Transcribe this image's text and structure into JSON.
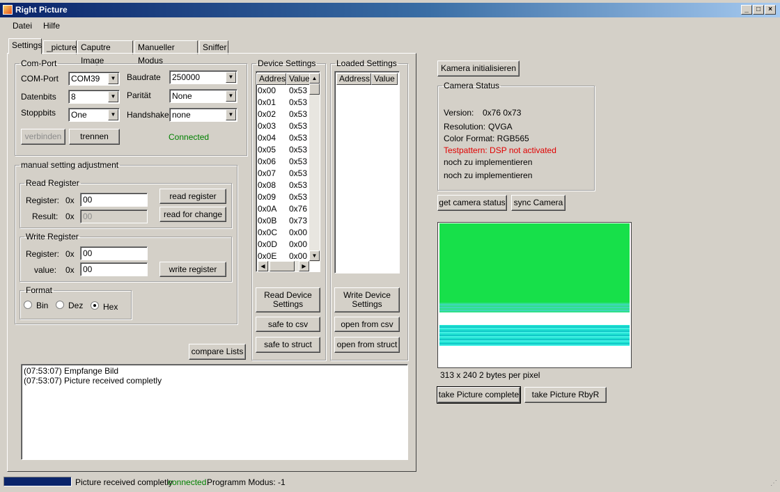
{
  "window": {
    "title": "Right Picture",
    "min": "_",
    "max": "□",
    "close": "×"
  },
  "menu": [
    "Datei",
    "Hilfe"
  ],
  "tabs": [
    "Settings",
    "_picture",
    "Caputre Image",
    "Manueller Modus",
    "Sniffer"
  ],
  "comport": {
    "legend": "Com-Port",
    "comport_label": "COM-Port",
    "comport_value": "COM39",
    "baudrate_label": "Baudrate",
    "baudrate_value": "250000",
    "datenbits_label": "Datenbits",
    "datenbits_value": "8",
    "paritaet_label": "Parität",
    "paritaet_value": "None",
    "stoppbits_label": "Stoppbits",
    "stoppbits_value": "One",
    "handshake_label": "Handshake",
    "handshake_value": "none",
    "connect_button": "verbinden",
    "disconnect_button": "trennen",
    "status": "Connected",
    "status_color": "#008000"
  },
  "manual": {
    "legend": "manual setting adjustment",
    "read": {
      "legend": "Read Register",
      "register_label": "Register:",
      "result_label": "Result:",
      "prefix": "0x",
      "register_value": "00",
      "result_value": "00",
      "read_button": "read register",
      "change_button": "read for change"
    },
    "write": {
      "legend": "Write Register",
      "register_label": "Register:",
      "value_label": "value:",
      "prefix": "0x",
      "register_value": "00",
      "value_value": "00",
      "write_button": "write register"
    },
    "format": {
      "legend": "Format",
      "bin": "Bin",
      "dez": "Dez",
      "hex": "Hex",
      "selected": "Hex"
    }
  },
  "compare_button": "compare Lists",
  "device_settings": {
    "legend": "Device Settings",
    "col_address": "Address",
    "col_value": "Value",
    "rows": [
      [
        "0x00",
        "0x53"
      ],
      [
        "0x01",
        "0x53"
      ],
      [
        "0x02",
        "0x53"
      ],
      [
        "0x03",
        "0x53"
      ],
      [
        "0x04",
        "0x53"
      ],
      [
        "0x05",
        "0x53"
      ],
      [
        "0x06",
        "0x53"
      ],
      [
        "0x07",
        "0x53"
      ],
      [
        "0x08",
        "0x53"
      ],
      [
        "0x09",
        "0x53"
      ],
      [
        "0x0A",
        "0x76"
      ],
      [
        "0x0B",
        "0x73"
      ],
      [
        "0x0C",
        "0x00"
      ],
      [
        "0x0D",
        "0x00"
      ],
      [
        "0x0E",
        "0x00"
      ]
    ],
    "read_button": "Read Device Settings",
    "save_csv_button": "safe to csv",
    "save_struct_button": "safe to struct"
  },
  "loaded_settings": {
    "legend": "Loaded Settings",
    "col_address": "Address",
    "col_value": "Value",
    "write_button": "Write Device Settings",
    "open_csv_button": "open from csv",
    "open_struct_button": "open from struct"
  },
  "log": [
    "(07:53:07) Empfange Bild",
    "(07:53:07) Picture received completly"
  ],
  "camera": {
    "init_button": "Kamera initialisieren",
    "status_legend": "Camera Status",
    "version_label": "Version:",
    "version_value": "0x76 0x73",
    "resolution_label": "Resolution:",
    "resolution_value": "QVGA",
    "color_format": "Color Format: RGB565",
    "testpattern": "Testpattern: DSP not activated",
    "testpattern_color": "#e00000",
    "line5": "noch zu implementieren",
    "line6": "noch zu implementieren",
    "get_status_button": "get camera status",
    "sync_button": "sync Camera",
    "image_caption": "313 x 240 2 bytes per pixel",
    "take_complete_button": "take Picture complete",
    "take_rbyr_button": "take Picture RbyR"
  },
  "statusbar": {
    "progress": 1.0,
    "message": "Picture received completly",
    "connection": "connected",
    "connection_color": "#008000",
    "mode": "Programm Modus: -1"
  }
}
